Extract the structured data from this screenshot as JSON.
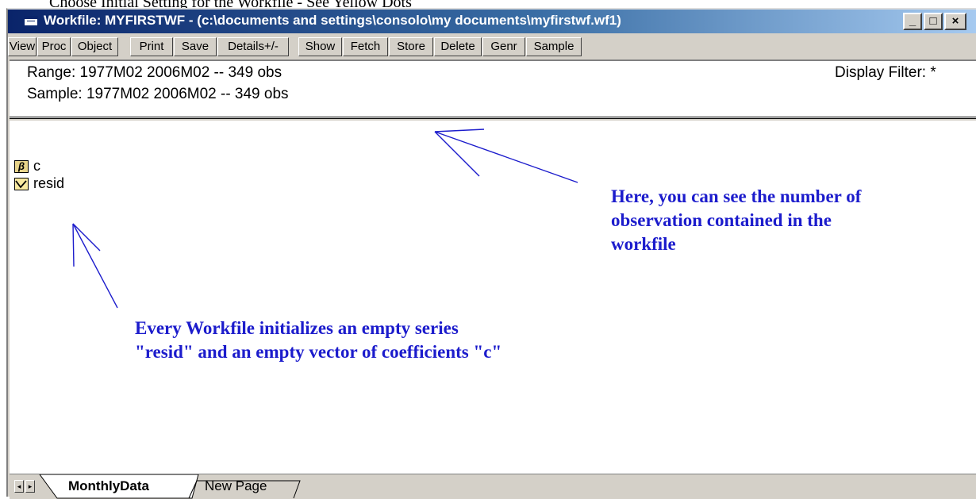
{
  "caption": "Choose Initial Setting for the Workfile - See Yellow Dots",
  "window": {
    "title": "Workfile: MYFIRSTWF - (c:\\documents and settings\\consolo\\my documents\\myfirstwf.wf1)",
    "controls": {
      "minimize": "_",
      "maximize": "□",
      "close": "×"
    }
  },
  "toolbar": {
    "buttons": [
      "View",
      "Proc",
      "Object",
      "Print",
      "Save",
      "Details+/-",
      "Show",
      "Fetch",
      "Store",
      "Delete",
      "Genr",
      "Sample"
    ]
  },
  "info": {
    "range": "Range:   1977M02 2006M02   --   349 obs",
    "sample": "Sample: 1977M02 2006M02   --   349 obs",
    "display_filter": "Display Filter: *"
  },
  "objects": [
    {
      "name": "c",
      "icon": "coefficient-vector-icon",
      "glyph": "β"
    },
    {
      "name": "resid",
      "icon": "series-icon"
    }
  ],
  "annotations": {
    "observations": [
      "Here, you can see the number of",
      "observation contained in the",
      "workfile"
    ],
    "resid": [
      "Every Workfile initializes an empty series",
      "\"resid\"  and an empty vector of coefficients \"c\""
    ]
  },
  "tabs": [
    {
      "label": "MonthlyData",
      "active": true
    },
    {
      "label": "New Page",
      "active": false
    }
  ],
  "colors": {
    "annotation": "#1c1ccc",
    "titlebar": "#0a246a"
  }
}
